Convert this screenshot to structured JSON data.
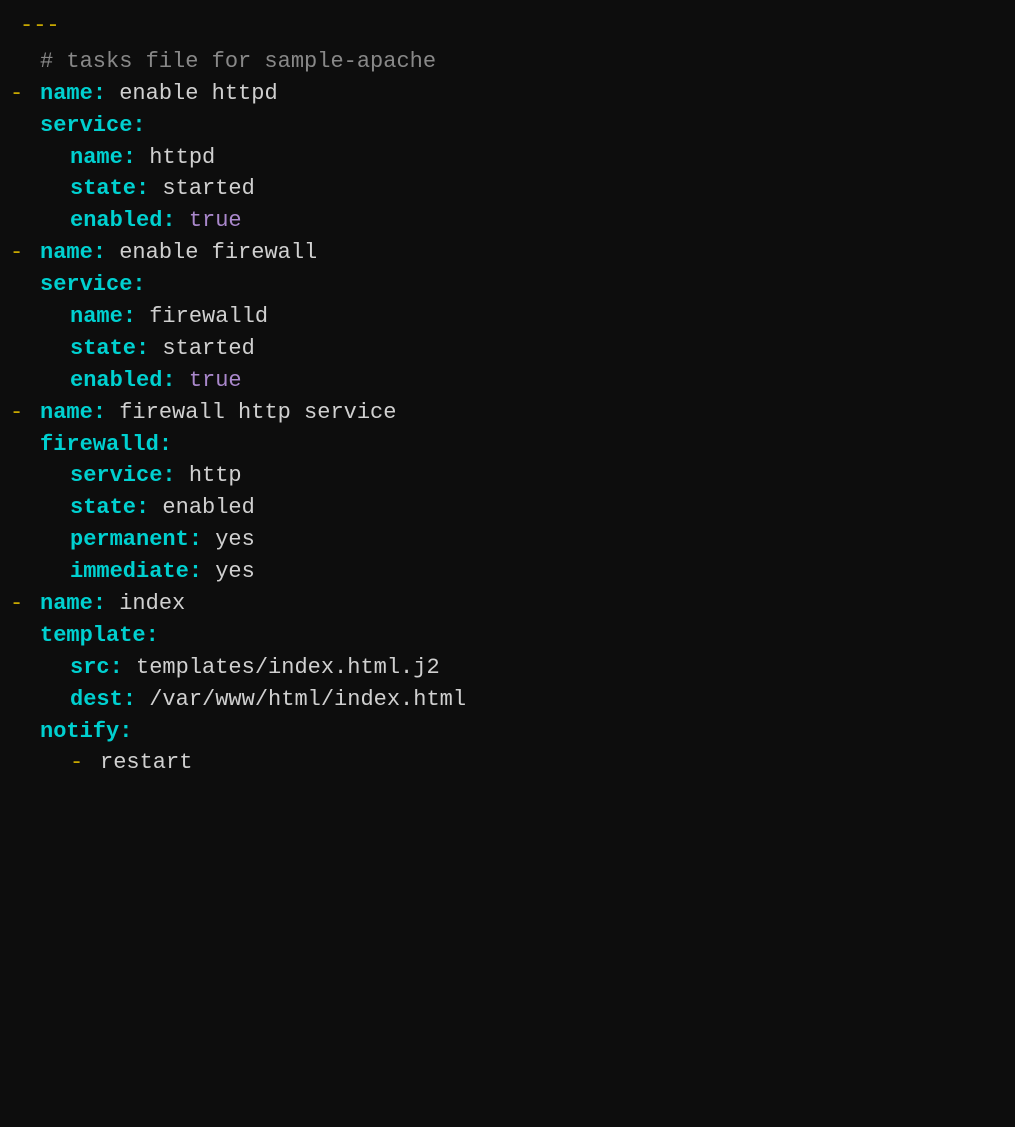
{
  "header": {
    "dashes": "---",
    "comment": "# tasks file for sample-apache"
  },
  "tasks": [
    {
      "dash": "-",
      "name_key": "name",
      "name_value": "enable httpd",
      "module": "service",
      "fields": [
        {
          "key": "name",
          "value": "httpd",
          "value_type": "white"
        },
        {
          "key": "state",
          "value": "started",
          "value_type": "white"
        },
        {
          "key": "enabled",
          "value": "true",
          "value_type": "purple"
        }
      ]
    },
    {
      "dash": "-",
      "name_key": "name",
      "name_value": "enable firewall",
      "module": "service",
      "fields": [
        {
          "key": "name",
          "value": "firewalld",
          "value_type": "white"
        },
        {
          "key": "state",
          "value": "started",
          "value_type": "white"
        },
        {
          "key": "enabled",
          "value": "true",
          "value_type": "purple"
        }
      ]
    },
    {
      "dash": "-",
      "name_key": "name",
      "name_value": "firewall http service",
      "module": "firewalld",
      "fields": [
        {
          "key": "service",
          "value": "http",
          "value_type": "white"
        },
        {
          "key": "state",
          "value": "enabled",
          "value_type": "white"
        },
        {
          "key": "permanent",
          "value": "yes",
          "value_type": "white"
        },
        {
          "key": "immediate",
          "value": "yes",
          "value_type": "white"
        }
      ]
    },
    {
      "dash": "-",
      "name_key": "name",
      "name_value": "index",
      "module": "template",
      "fields": [
        {
          "key": "src",
          "value": "templates/index.html.j2",
          "value_type": "white"
        },
        {
          "key": "dest",
          "value": "/var/www/html/index.html",
          "value_type": "white"
        }
      ],
      "notify": {
        "key": "notify",
        "items": [
          "restart"
        ]
      }
    }
  ]
}
